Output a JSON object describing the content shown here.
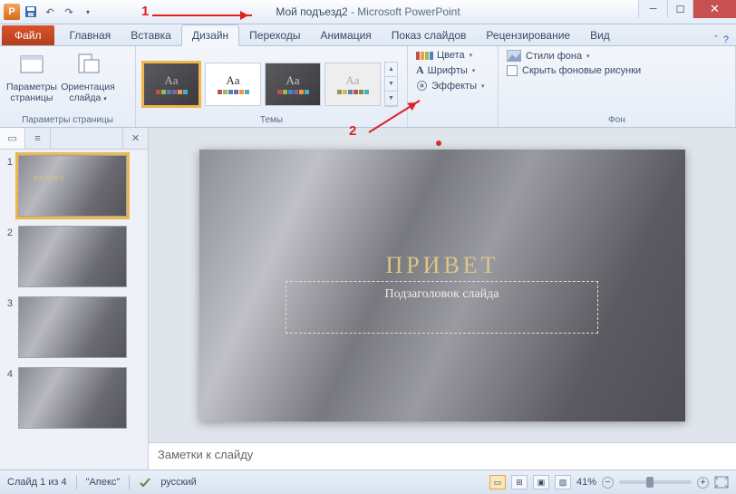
{
  "title": {
    "doc": "Мой подъезд2",
    "app": "Microsoft PowerPoint"
  },
  "tabs": {
    "file": "Файл",
    "home": "Главная",
    "insert": "Вставка",
    "design": "Дизайн",
    "transitions": "Переходы",
    "animations": "Анимация",
    "slideshow": "Показ слайдов",
    "review": "Рецензирование",
    "view": "Вид"
  },
  "ribbon": {
    "page_setup": {
      "label": "Параметры\nстраницы",
      "orient": "Ориентация\nслайда",
      "group": "Параметры страницы"
    },
    "themes": {
      "group": "Темы"
    },
    "format": {
      "colors": "Цвета",
      "fonts": "Шрифты",
      "effects": "Эффекты"
    },
    "background": {
      "styles": "Стили фона",
      "hide": "Скрыть фоновые рисунки",
      "group": "Фон"
    }
  },
  "slide": {
    "title": "ПРИВЕТ",
    "subtitle": "Подзаголовок слайда",
    "thumb_title": "ПРИВЕТ"
  },
  "notes": {
    "placeholder": "Заметки к слайду"
  },
  "status": {
    "slide": "Слайд 1 из 4",
    "theme": "\"Апекс\"",
    "lang": "русский",
    "zoom": "41%"
  },
  "annotations": {
    "n1": "1",
    "n2": "2"
  },
  "thumbs": [
    "1",
    "2",
    "3",
    "4"
  ]
}
